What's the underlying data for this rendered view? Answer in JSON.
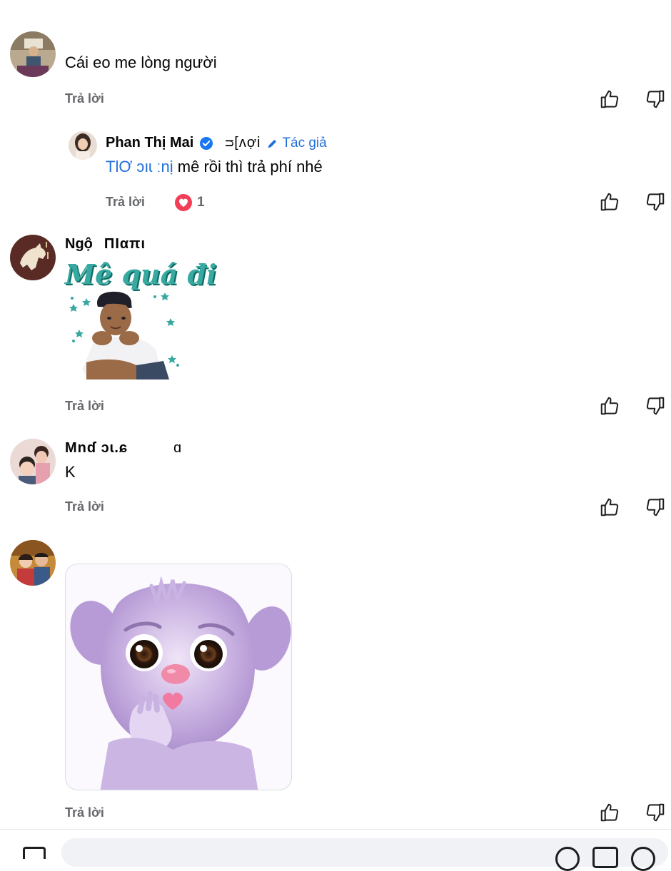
{
  "comments": [
    {
      "author": "",
      "text": "Cái eo me lòng người",
      "reply_label": "Trả lời"
    },
    {
      "author": "Phan Thị Mai",
      "verified": true,
      "author_suffix": "ᴝ[ᴧợi",
      "author_badge": "Tác giả",
      "mention": "TlƠ ɔıɩ ːnị",
      "text": "mê rồi thì trả phí nhé",
      "reply_label": "Trả lời",
      "reaction_count": "1",
      "reaction": "love"
    },
    {
      "author": "Ngộ",
      "author_scribble": "ΠΙαπι",
      "sticker_text": "Mê quá đi",
      "reply_label": "Trả lời"
    },
    {
      "author": "Mnɗ ɔɩ.ɕ",
      "author_tail": "ɑ",
      "text": "K",
      "reply_label": "Trả lời"
    },
    {
      "author": "",
      "sticker": "purple-fluffy-creature-blowing-kiss",
      "reply_label": "Trả lời"
    }
  ],
  "colors": {
    "accent": "#216fdb",
    "muted": "#65676b",
    "love": "#f33e58",
    "verified": "#1877f2",
    "sticker_teal": "#37a9a1"
  },
  "icons": {
    "like": "thumbs-up-icon",
    "dislike": "thumbs-down-icon",
    "love": "heart-reaction-icon",
    "verified": "verified-badge-icon",
    "author": "pencil-icon"
  }
}
